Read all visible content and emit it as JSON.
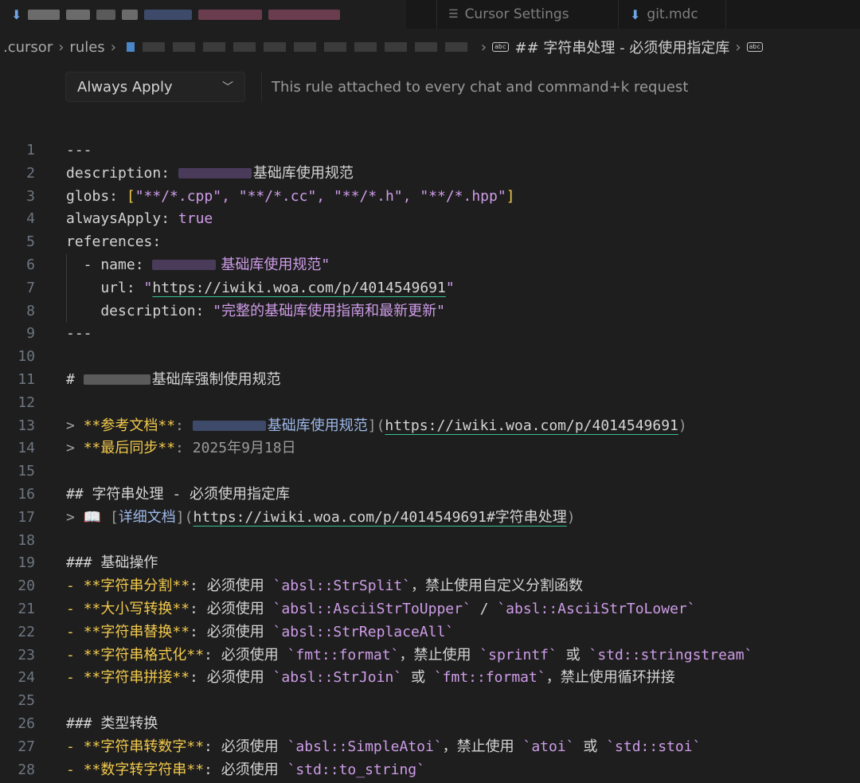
{
  "tabs": [
    {
      "label": ""
    },
    {
      "label": "Cursor Settings"
    },
    {
      "label": "git.mdc"
    }
  ],
  "breadcrumb": {
    "items": [
      ".cursor",
      "rules"
    ],
    "current": "## 字符串处理 - 必须使用指定库"
  },
  "apply": {
    "mode": "Always Apply",
    "description": "This rule attached to every chat and command+k request"
  },
  "editor": {
    "line_numbers": [
      "1",
      "2",
      "3",
      "4",
      "5",
      "6",
      "7",
      "8",
      "9",
      "10",
      "11",
      "12",
      "13",
      "14",
      "15",
      "16",
      "17",
      "18",
      "19",
      "20",
      "21",
      "22",
      "23",
      "24",
      "25",
      "26",
      "27",
      "28"
    ],
    "l1": "---",
    "l2_key": "description: ",
    "l2_val": "基础库使用规范",
    "l3_key": "globs: ",
    "l3_open": "[",
    "l3_vals": "\"**/*.cpp\", \"**/*.cc\", \"**/*.h\", \"**/*.hpp\"",
    "l3_close": "]",
    "l4_key": "alwaysApply: ",
    "l4_val": "true",
    "l5_key": "references:",
    "l6_key": "  - name: ",
    "l6_val": "基础库使用规范\"",
    "l7_key": "    url: ",
    "l7_q1": "\"",
    "l7_url": "https://iwiki.woa.com/p/4014549691",
    "l7_q2": "\"",
    "l8_key": "    description: ",
    "l8_val": "\"完整的基础库使用指南和最新更新\"",
    "l9": "---",
    "l11_h": "# ",
    "l11_text": "基础库强制使用规范",
    "l13_q": "> ",
    "l13_bold": "**参考文档**",
    "l13_colon": ": ",
    "l13_link": "基础库使用规范",
    "l13_close": "](",
    "l13_url": "https://iwiki.woa.com/p/4014549691",
    "l13_end": ")",
    "l14_q": "> ",
    "l14_bold": "**最后同步**",
    "l14_colon": ": ",
    "l14_date": "2025年9月18日",
    "l16": "## 字符串处理 - 必须使用指定库",
    "l17_q": "> ",
    "l17_icon": "📖",
    "l17_open": " [",
    "l17_link": "详细文档",
    "l17_close": "](",
    "l17_url": "https://iwiki.woa.com/p/4014549691#字符串处理",
    "l17_end": ")",
    "l19": "### 基础操作",
    "l20_bold": "**字符串分割**",
    "l20_a": ": 必须使用 ",
    "l20_c1": "`absl::StrSplit`",
    "l20_b": "，禁止使用自定义分割函数",
    "l21_bold": "**大小写转换**",
    "l21_a": ": 必须使用 ",
    "l21_c1": "`absl::AsciiStrToUpper`",
    "l21_b": " / ",
    "l21_c2": "`absl::AsciiStrToLower`",
    "l22_bold": "**字符串替换**",
    "l22_a": ": 必须使用 ",
    "l22_c1": "`absl::StrReplaceAll`",
    "l23_bold": "**字符串格式化**",
    "l23_a": ": 必须使用 ",
    "l23_c1": "`fmt::format`",
    "l23_b": "，禁止使用 ",
    "l23_c2": "`sprintf`",
    "l23_c": " 或 ",
    "l23_c3": "`std::stringstream`",
    "l24_bold": "**字符串拼接**",
    "l24_a": ": 必须使用 ",
    "l24_c1": "`absl::StrJoin`",
    "l24_b": " 或 ",
    "l24_c2": "`fmt::format`",
    "l24_c": "，禁止使用循环拼接",
    "l26": "### 类型转换",
    "l27_bold": "**字符串转数字**",
    "l27_a": ": 必须使用 ",
    "l27_c1": "`absl::SimpleAtoi`",
    "l27_b": "，禁止使用 ",
    "l27_c2": "`atoi`",
    "l27_c": " 或 ",
    "l27_c3": "`std::stoi`",
    "l28_bold": "**数字转字符串**",
    "l28_a": ": 必须使用 ",
    "l28_c1": "`std::to_string`",
    "dash": "- "
  }
}
